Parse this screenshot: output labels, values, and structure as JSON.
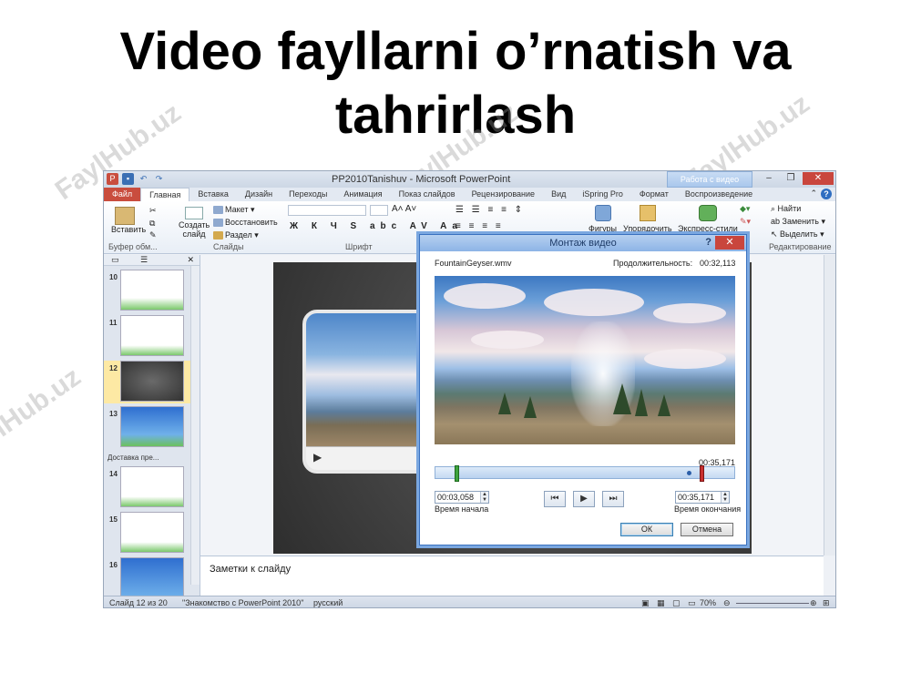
{
  "slide": {
    "title": "Video fayllarni o’rnatish va tahrirlash",
    "watermark": "FaylHub.uz"
  },
  "app": {
    "title": "PP2010Tanishuv - Microsoft PowerPoint",
    "context_tab": "Работа с видео",
    "tabs": [
      "Файл",
      "Главная",
      "Вставка",
      "Дизайн",
      "Переходы",
      "Анимация",
      "Показ слайдов",
      "Рецензирование",
      "Вид",
      "iSpring Pro",
      "Формат",
      "Воспроизведение"
    ],
    "active_tab": "Главная"
  },
  "ribbon": {
    "clipboard": {
      "paste": "Вставить",
      "label": "Буфер обм..."
    },
    "slides": {
      "new_slide": "Создать слайд",
      "layout": "Макет",
      "reset": "Восстановить",
      "section": "Раздел",
      "label": "Слайды"
    },
    "font": {
      "label": "Шрифт"
    },
    "drawing": {
      "shapes": "Фигуры",
      "arrange": "Упорядочить",
      "quick_styles": "Экспресс-стили"
    },
    "editing": {
      "find": "Найти",
      "replace": "Заменить",
      "select": "Выделить",
      "label": "Редактирование"
    }
  },
  "thumbnails": {
    "items": [
      {
        "num": "10"
      },
      {
        "num": "11"
      },
      {
        "num": "12"
      },
      {
        "num": "13"
      },
      {
        "num": "14"
      },
      {
        "num": "15"
      },
      {
        "num": "16"
      }
    ],
    "active": "12",
    "section_label": "Доставка пре..."
  },
  "notes": {
    "placeholder": "Заметки к слайду"
  },
  "statusbar": {
    "slide_info": "Слайд 12 из 20",
    "theme": "\"Знакомство с PowerPoint 2010\"",
    "language": "русский",
    "zoom": "70%"
  },
  "dialog": {
    "title": "Монтаж видео",
    "help": "?",
    "file_name": "FountainGeyser.wmv",
    "duration_label": "Продолжительность:",
    "duration_value": "00:32,113",
    "end_time_display": "00:35,171",
    "start_time": "00:03,058",
    "end_time": "00:35,171",
    "start_label": "Время начала",
    "end_label": "Время окончания",
    "ok": "ОК",
    "cancel": "Отмена",
    "trim": {
      "start_fraction": 0.065,
      "end_fraction": 0.885,
      "playhead_fraction": 0.84
    }
  },
  "colors": {
    "file_tab": "#c94d3e",
    "close_button": "#c9463d",
    "dialog_border": "#3a72c0",
    "start_handle": "#3ea33e",
    "end_handle": "#c93030"
  }
}
